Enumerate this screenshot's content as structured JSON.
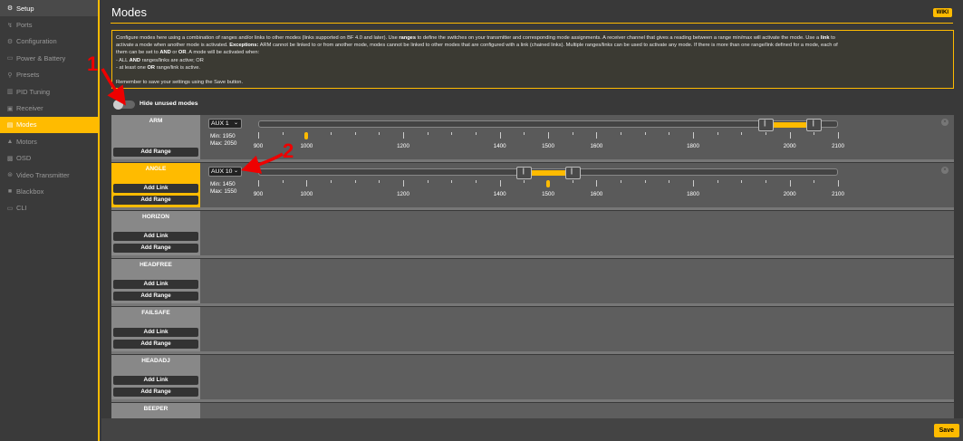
{
  "sidebar": {
    "items": [
      {
        "label": "Setup",
        "icon": "wrench-icon"
      },
      {
        "label": "Ports",
        "icon": "plug-icon"
      },
      {
        "label": "Configuration",
        "icon": "gear-icon"
      },
      {
        "label": "Power & Battery",
        "icon": "battery-icon"
      },
      {
        "label": "Presets",
        "icon": "presets-icon"
      },
      {
        "label": "PID Tuning",
        "icon": "pid-icon"
      },
      {
        "label": "Receiver",
        "icon": "receiver-icon"
      },
      {
        "label": "Modes",
        "icon": "modes-icon"
      },
      {
        "label": "Motors",
        "icon": "motor-icon"
      },
      {
        "label": "OSD",
        "icon": "osd-icon"
      },
      {
        "label": "Video Transmitter",
        "icon": "antenna-icon"
      },
      {
        "label": "Blackbox",
        "icon": "blackbox-icon"
      },
      {
        "label": "CLI",
        "icon": "terminal-icon"
      }
    ]
  },
  "header": {
    "title": "Modes",
    "wiki": "WIKI"
  },
  "info": {
    "l1a": "Configure modes here using a combination of ranges and/or links to other modes (links supported on BF 4.0 and later). Use ",
    "l1b": "ranges",
    "l1c": " to define the switches on your transmitter and corresponding mode assignments. A receiver channel that gives a reading between a range min/max will activate the mode. Use a ",
    "l1d": "link",
    "l1e": " to",
    "l2a": "activate a mode when another mode is activated. ",
    "l2b": "Exceptions:",
    "l2c": " ARM cannot be linked to or from another mode, modes cannot be linked to other modes that are configured with a link (chained links). Multiple ranges/links can be used to activate any mode. If there is more than one range/link defined for a mode, each of",
    "l3a": "them can be set to ",
    "l3b": "AND",
    "l3c": " or ",
    "l3d": "OR",
    "l3e": ". A mode will be activated when:",
    "l4a": "- ALL ",
    "l4b": "AND",
    "l4c": " ranges/links are active; OR",
    "l5a": "- at least one ",
    "l5b": "OR",
    "l5c": " range/link is active.",
    "l6": "Remember to save your settings using the Save button."
  },
  "hide_unused_label": "Hide unused modes",
  "buttons": {
    "add_link": "Add Link",
    "add_range": "Add Range",
    "save": "Save"
  },
  "modes": [
    {
      "name": "ARM",
      "aux": "AUX 1",
      "min": "Min: 1950",
      "max": "Max: 2050",
      "range_min": 1950,
      "range_max": 2050,
      "channel_value": 1000
    },
    {
      "name": "ANGLE",
      "aux": "AUX 10",
      "min": "Min: 1450",
      "max": "Max: 1550",
      "range_min": 1450,
      "range_max": 1550,
      "channel_value": 1500
    },
    {
      "name": "HORIZON"
    },
    {
      "name": "HEADFREE"
    },
    {
      "name": "FAILSAFE"
    },
    {
      "name": "HEADADJ"
    },
    {
      "name": "BEEPER"
    }
  ],
  "scale": {
    "min": 900,
    "max": 2100,
    "labels": [
      "900",
      "1000",
      "1200",
      "1400",
      "1500",
      "1600",
      "1800",
      "2000",
      "2100"
    ]
  },
  "annotations": [
    "1",
    "2"
  ],
  "colors": {
    "accent": "#ffbb00",
    "annotation": "#ee0000"
  }
}
